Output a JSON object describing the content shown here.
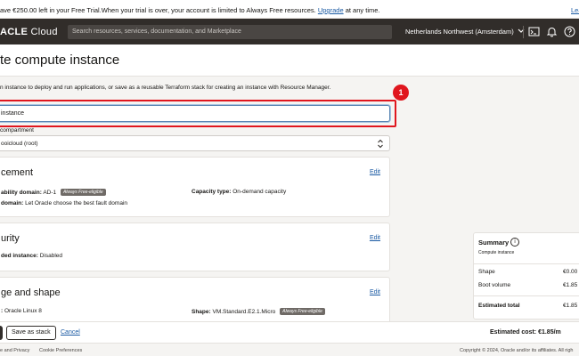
{
  "banner": {
    "message_prefix": "ave €250.00 left in your Free Trial.When your trial is over, your account is limited to Always Free resources.",
    "upgrade_link": "Upgrade",
    "message_suffix": "at any time.",
    "right_link": "Lea"
  },
  "topbar": {
    "brand_bold": "ACLE",
    "brand_light": "Cloud",
    "search_placeholder": "Search resources, services, documentation, and Marketplace",
    "region": "Netherlands Northwest (Amsterdam)",
    "icons": [
      "chevron-down-icon",
      "cloud-shell-icon",
      "bell-icon",
      "help-icon"
    ]
  },
  "page": {
    "title": "te compute instance",
    "intro": "n instance to deploy and run applications, or save as a reusable Terraform stack for creating an instance with Resource Manager.",
    "name_value": "instance",
    "annotation_number": "1",
    "compartment_label": "compartment",
    "compartment_value": "ooicloud (root)"
  },
  "placement": {
    "title": "cement",
    "edit": "Edit",
    "availability_domain_label": "ability domain:",
    "availability_domain_value": "AD-1",
    "availability_tag": "Always Free-eligible",
    "fault_domain_label": "domain:",
    "fault_domain_value": "Let Oracle choose the best fault domain",
    "capacity_label": "Capacity type:",
    "capacity_value": "On-demand capacity"
  },
  "security": {
    "title": "urity",
    "edit": "Edit",
    "shielded_label": "ded instance:",
    "shielded_value": "Disabled"
  },
  "image_shape": {
    "title": "ge and shape",
    "edit": "Edit",
    "image_label": ":",
    "image_value": "Oracle Linux 8",
    "shape_label": "Shape:",
    "shape_value": "VM.Standard.E2.1.Micro",
    "shape_tag": "Always Free-eligible"
  },
  "summary": {
    "title": "Summary",
    "subtitle": "Compute instance",
    "rows": [
      {
        "label": "Shape",
        "value": "€0.00"
      },
      {
        "label": "Boot volume",
        "value": "€1.85"
      }
    ],
    "total_label": "Estimated total",
    "total_value": "€1.85"
  },
  "footer": {
    "save_stack": "Save as stack",
    "cancel": "Cancel",
    "estimated_cost": "Estimated cost: €1.85/m"
  },
  "bottom": {
    "left1": "e and Privacy",
    "left2": "Cookie Preferences",
    "right": "Copyright © 2024, Oracle and/or its affiliates. All righ"
  }
}
